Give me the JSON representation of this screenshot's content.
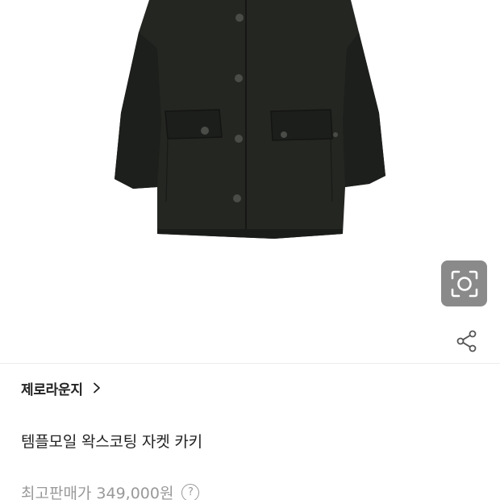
{
  "product_image": {
    "icon": "jacket-image"
  },
  "tools": {
    "lens_icon": "image-search-icon",
    "share_icon": "share-icon"
  },
  "store": {
    "name": "제로라운지",
    "chevron_icon": "chevron-right-icon"
  },
  "product": {
    "title": "템플모일 왁스코팅 자켓 카키"
  },
  "price": {
    "label": "최고판매가",
    "value": "349,000원",
    "help_icon": "question-circle-icon",
    "help_glyph": "?"
  },
  "colors": {
    "jacket": "#232522",
    "lens_bg": "#8a8a8a"
  }
}
